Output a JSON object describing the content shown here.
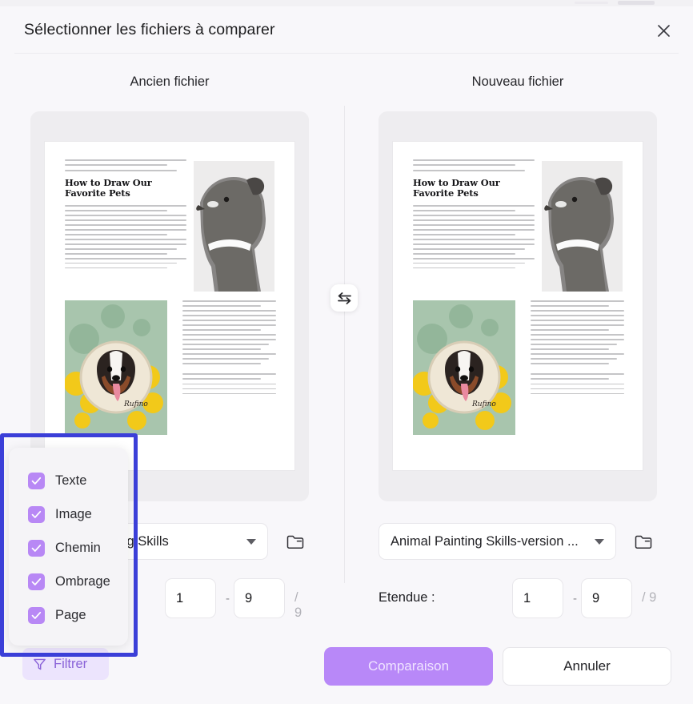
{
  "dialog": {
    "title": "Sélectionner les fichiers à comparer",
    "close_icon": "close-icon"
  },
  "columns": {
    "old_label": "Ancien fichier",
    "new_label": "Nouveau fichier"
  },
  "swap": {
    "icon": "swap-arrows-icon"
  },
  "document_preview": {
    "heading": "How to Draw Our Favorite Pets",
    "intro_lines": [
      "Animals have been part of human art from the beginning",
      "start. Earliest ancient painting, found hidden",
      "in the cave, animals such as bison (bison) are featured."
    ],
    "body_lines": [
      "Egyptian art celebrates animals like cats with style and style",
      "beauty. For centuries, this horse has inspired",
      "Paintings, sculptures, jewelry, and even armor. nowadays",
      "Times, cat and dog art sells a lot of t-shirts, calendars, coffee",
      "Cups, store brands and other items. Whether it is art or domestic",
      "Animals are a part of our daily life, the combination of the two",
      "Beautifully together",
      "This combination is the subject of this book. artist's",
      "The Animal Drawing Guide aims to provide people with",
      "Various skill levels, stepping stones for improvement",
      "Their animal renderings. I provide many sketches and",
      "Step-by-step examples to help readers see the different ways",
      "Build the anatomy of an animal. some of them are quite",
      "Basic and other more advanced ones. Please choose"
    ],
    "sketch_alt": "dog-pencil-sketch",
    "photo_alt": "embroidered-dog-portrait-photo"
  },
  "old_file": {
    "select_value": "Animal Painting Skills",
    "folder_icon": "folder-icon",
    "range_from": "1",
    "range_to": "9",
    "range_total": "/ 9",
    "range_separator": "-"
  },
  "new_file": {
    "range_label": "Etendue :",
    "select_value": "Animal Painting Skills-version ...",
    "folder_icon": "folder-icon",
    "range_from": "1",
    "range_to": "9",
    "range_total": "/ 9",
    "range_separator": "-"
  },
  "filter": {
    "button_label": "Filtrer",
    "icon": "funnel-icon",
    "options": [
      {
        "label": "Texte",
        "checked": true
      },
      {
        "label": "Image",
        "checked": true
      },
      {
        "label": "Chemin",
        "checked": true
      },
      {
        "label": "Ombrage",
        "checked": true
      },
      {
        "label": "Page",
        "checked": true
      }
    ]
  },
  "actions": {
    "compare_label": "Comparaison",
    "cancel_label": "Annuler"
  },
  "colors": {
    "accent_purple": "#b888f8",
    "checkbox_purple": "#b888f5",
    "filter_bg": "#ece4fd",
    "filter_text": "#8a63d8",
    "focus_blue": "#3b3fd8",
    "dialog_bg": "#f8f7fa",
    "preview_bg": "#eeedf0"
  }
}
